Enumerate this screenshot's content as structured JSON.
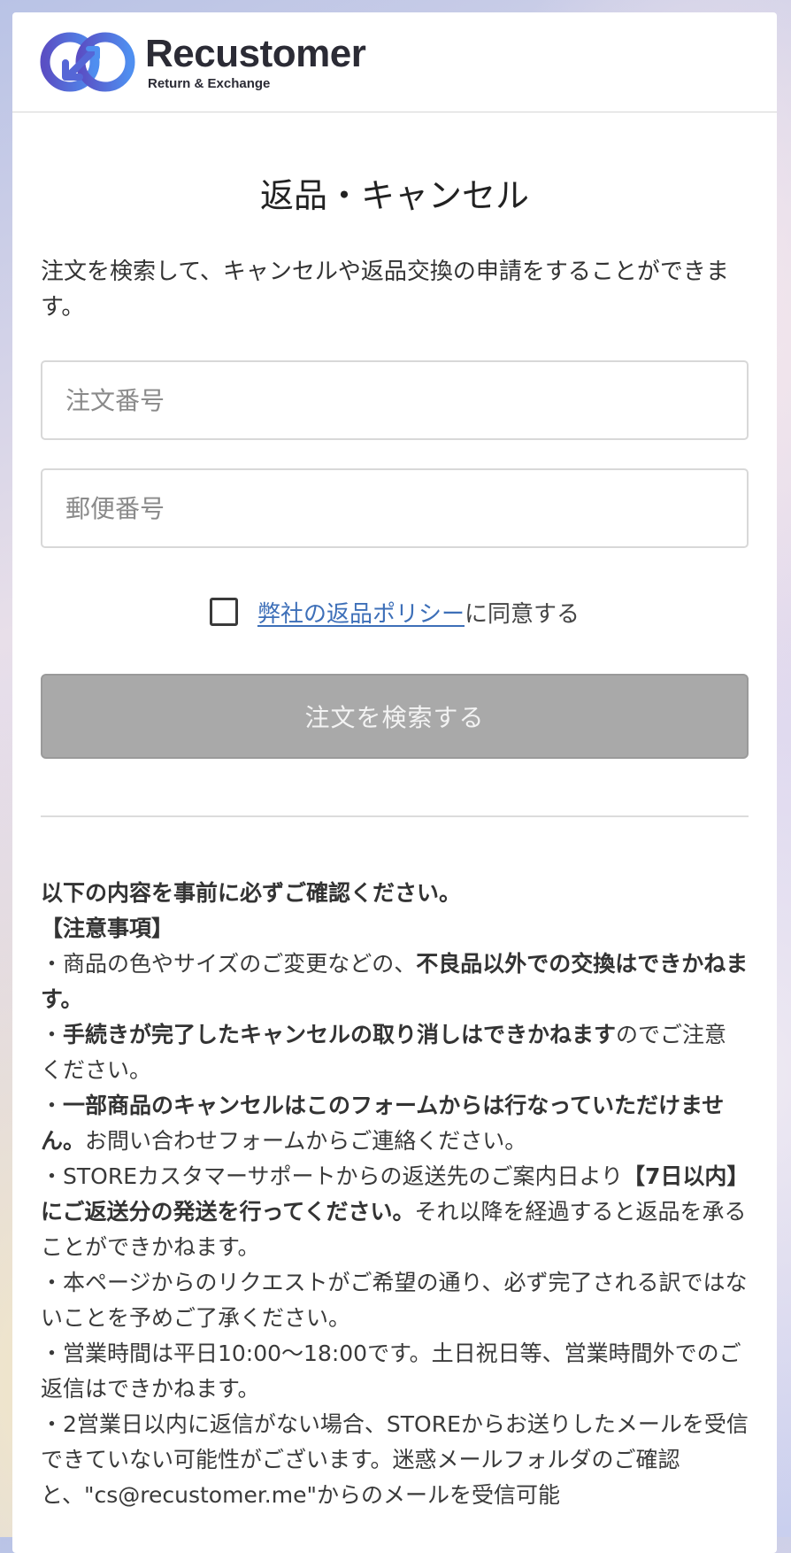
{
  "header": {
    "brand_name": "Recustomer",
    "brand_tagline": "Return & Exchange",
    "logo_colors": [
      "#5a4fc4",
      "#4f8ff0"
    ]
  },
  "page": {
    "title": "返品・キャンセル",
    "intro": "注文を検索して、キャンセルや返品交換の申請をすることができます。"
  },
  "form": {
    "order_number_placeholder": "注文番号",
    "postal_code_placeholder": "郵便番号",
    "agree_checked": false,
    "policy_link_label": "弊社の返品ポリシー",
    "agree_suffix": "に同意する",
    "search_button_label": "注文を検索する",
    "search_button_enabled": false
  },
  "notice": {
    "heading": "以下の内容を事前に必ずご確認ください。",
    "subheading": "【注意事項】",
    "items": [
      [
        {
          "text": "・商品の色やサイズのご変更などの、",
          "bold": false
        },
        {
          "text": "不良品以外での交換はできかねます。",
          "bold": true
        }
      ],
      [
        {
          "text": "・",
          "bold": false
        },
        {
          "text": "手続きが完了したキャンセルの取り消しはできかねます",
          "bold": true
        },
        {
          "text": "のでご注意ください。",
          "bold": false
        }
      ],
      [
        {
          "text": "・",
          "bold": false
        },
        {
          "text": "一部商品のキャンセルはこのフォームからは行なっていただけません。",
          "bold": true
        },
        {
          "text": "お問い合わせフォームからご連絡ください。",
          "bold": false
        }
      ],
      [
        {
          "text": "・STOREカスタマーサポートからの返送先のご案内日より",
          "bold": false
        },
        {
          "text": "【7日以内】にご返送分の発送を行ってください。",
          "bold": true
        },
        {
          "text": "それ以降を経過すると返品を承ることができかねます。",
          "bold": false
        }
      ],
      [
        {
          "text": "・本ページからのリクエストがご希望の通り、必ず完了される訳ではないことを予めご了承ください。",
          "bold": false
        }
      ],
      [
        {
          "text": "・営業時間は平日10:00〜18:00です。土日祝日等、営業時間外でのご返信はできかねます。",
          "bold": false
        }
      ],
      [
        {
          "text": "・2営業日以内に返信がない場合、STOREからお送りしたメールを受信できていない可能性がございます。迷惑メールフォルダのご確認と、\"cs@recustomer.me\"からのメールを受信可能",
          "bold": false
        }
      ]
    ]
  }
}
